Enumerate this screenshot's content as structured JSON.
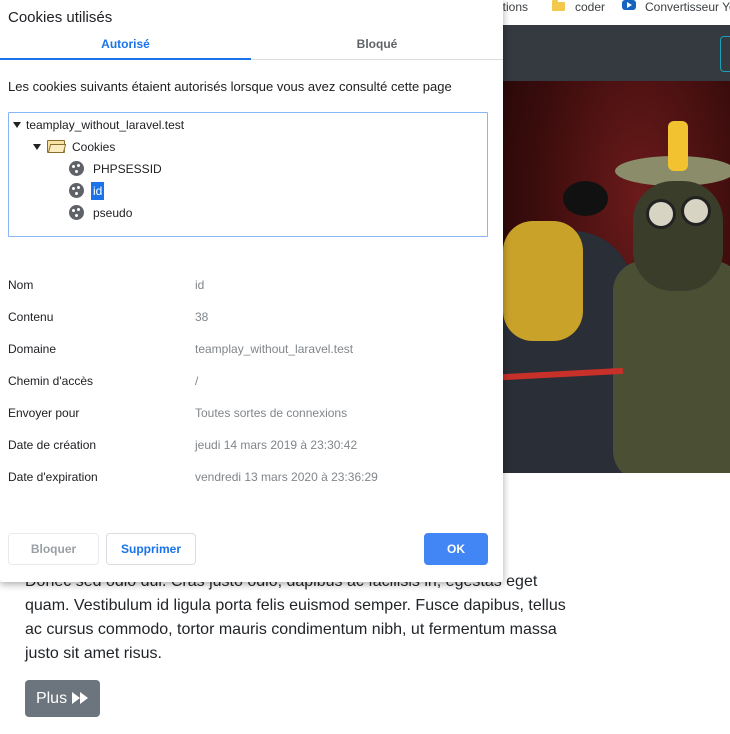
{
  "bookmarks": {
    "item1": "ations",
    "item2": "coder",
    "item3": "Convertisseur Yo"
  },
  "page": {
    "lorem": "Donec sed odio dui. Cras justo odio, dapibus ac facilisis in, egestas eget quam. Vestibulum id ligula porta felis euismod semper. Fusce dapibus, tellus ac cursus commodo, tortor mauris condimentum nibh, ut fermentum massa justo sit amet risus.",
    "plus_button": "Plus"
  },
  "dialog": {
    "title": "Cookies utilisés",
    "tabs": [
      "Autorisé",
      "Bloqué"
    ],
    "active_tab": "Autorisé",
    "description": "Les cookies suivants étaient autorisés lorsque vous avez consulté cette page",
    "tree": {
      "domain": "teamplay_without_laravel.test",
      "folder": "Cookies",
      "cookies": [
        "PHPSESSID",
        "id",
        "pseudo"
      ],
      "selected": "id"
    },
    "properties": [
      {
        "label": "Nom",
        "value": "id"
      },
      {
        "label": "Contenu",
        "value": "38"
      },
      {
        "label": "Domaine",
        "value": "teamplay_without_laravel.test"
      },
      {
        "label": "Chemin d'accès",
        "value": "/"
      },
      {
        "label": "Envoyer pour",
        "value": "Toutes sortes de connexions"
      },
      {
        "label": "Date de création",
        "value": "jeudi 14 mars 2019 à 23:30:42"
      },
      {
        "label": "Date d'expiration",
        "value": "vendredi 13 mars 2020 à 23:36:29"
      }
    ],
    "buttons": {
      "block": "Bloquer",
      "delete": "Supprimer",
      "ok": "OK"
    }
  },
  "colors": {
    "accent": "#1a73e8",
    "ok_button": "#4285f4",
    "navbar": "#343a40",
    "secondary_button": "#6c757d"
  },
  "icons": [
    "folder-icon",
    "youtube-icon",
    "expand-triangle-icon",
    "cookie-icon",
    "fast-forward-icon"
  ]
}
